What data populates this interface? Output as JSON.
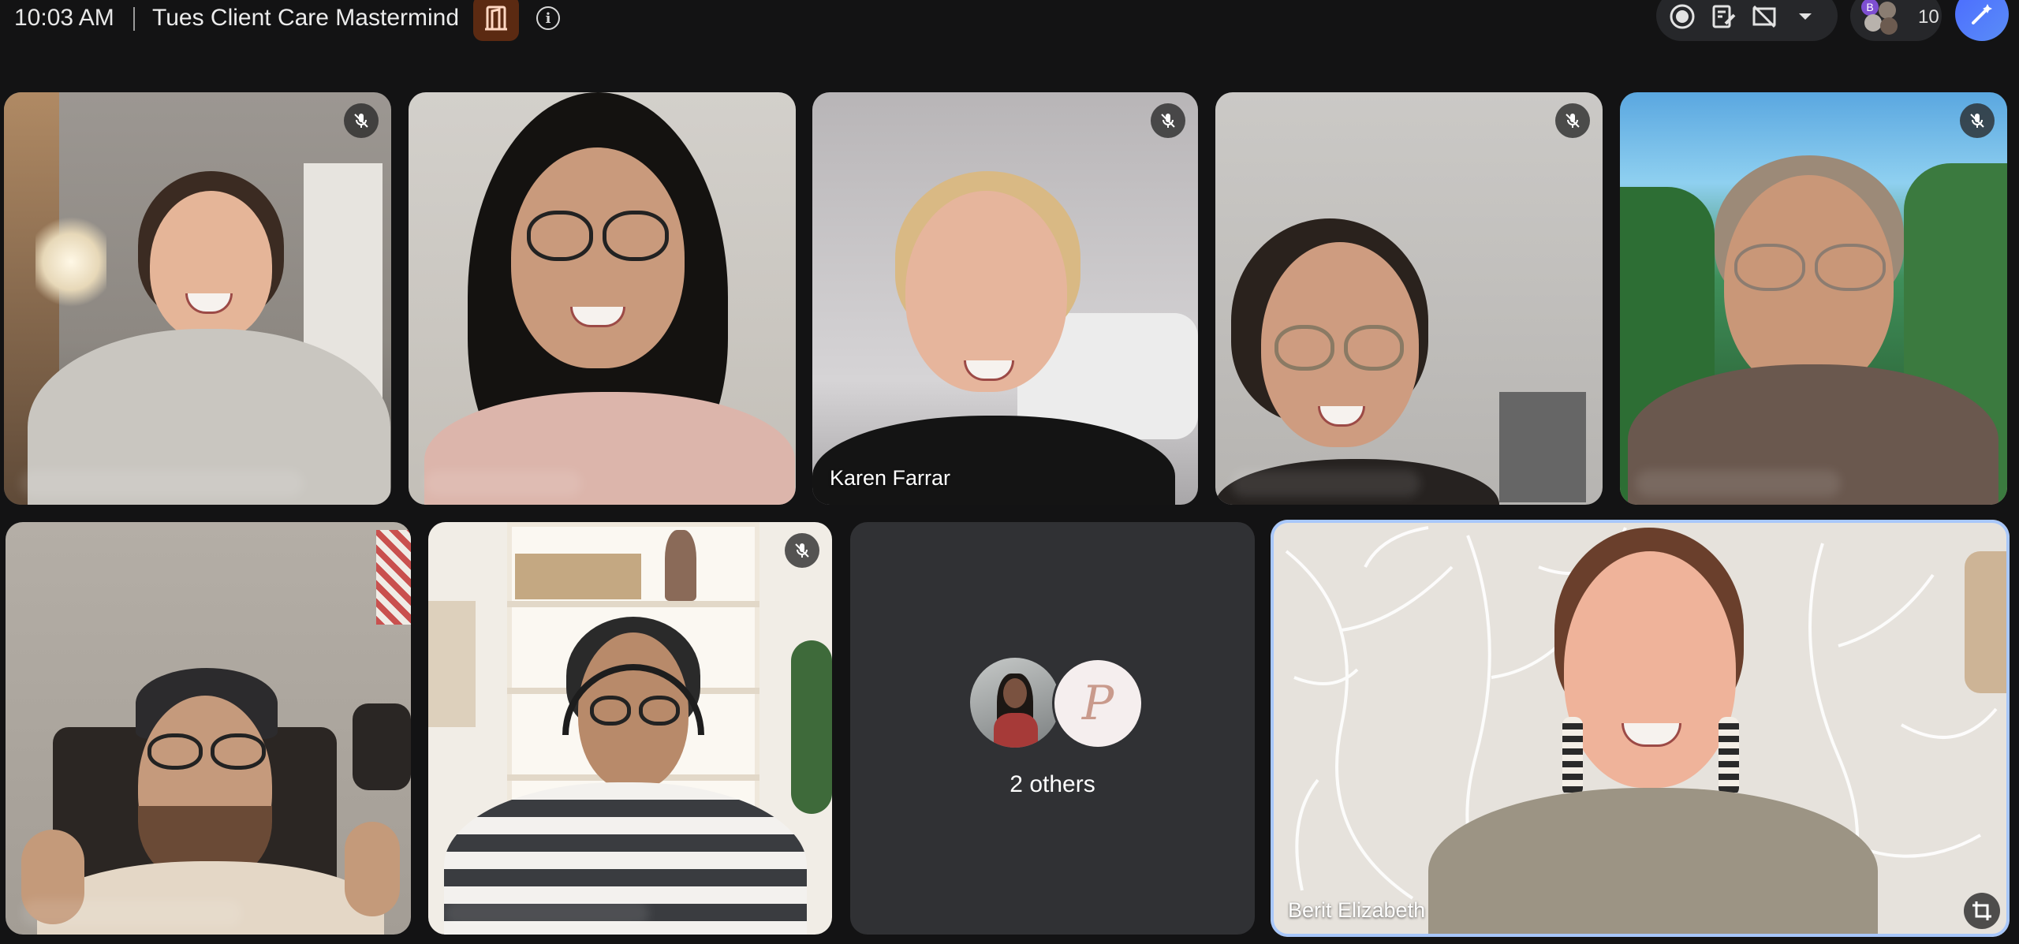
{
  "topbar": {
    "time": "10:03 AM",
    "meeting_title": "Tues Client Care Mastermind",
    "room_icon": "door-icon",
    "info_icon": "info-icon",
    "controls": [
      "record-icon",
      "notes-icon",
      "captions-off-icon",
      "chevron-down-icon"
    ],
    "participants_count": "10",
    "participant_mini_avatar_letter": "B",
    "edit_icon": "pen-sparkle-icon"
  },
  "tiles": [
    {
      "name": "",
      "muted": true
    },
    {
      "name": "",
      "muted": false
    },
    {
      "name": "Karen Farrar",
      "muted": true
    },
    {
      "name": "",
      "muted": true
    },
    {
      "name": "",
      "muted": true
    },
    {
      "name": "",
      "muted": false
    },
    {
      "name": "",
      "muted": true
    },
    {
      "name": "Berit Elizabeth",
      "muted": false,
      "selected": true
    }
  ],
  "others": {
    "label": "2 others",
    "avatar_letter": "P"
  },
  "colors": {
    "background": "#131314",
    "tile_placeholder": "#303134",
    "selected_border": "#a8c7fa",
    "room_button": "#5b2a12",
    "edit_button": "#4b6bff"
  }
}
